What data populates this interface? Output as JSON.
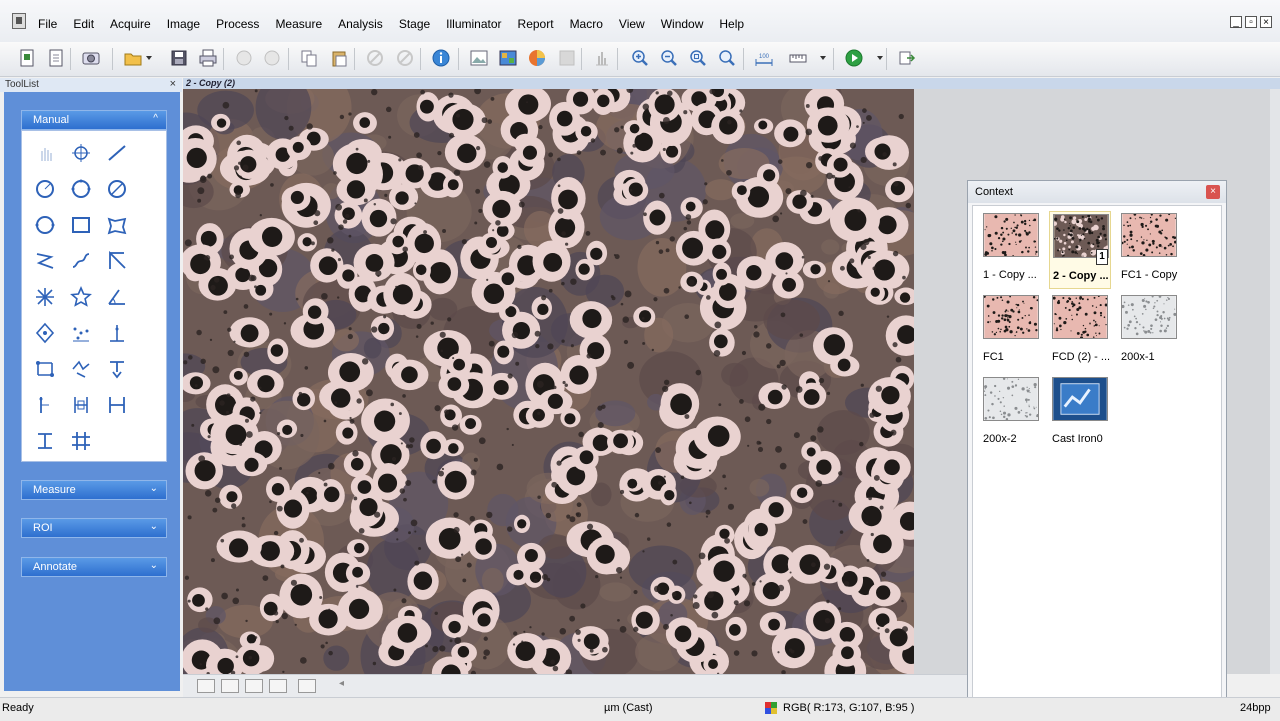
{
  "menu": {
    "items": [
      "File",
      "Edit",
      "Acquire",
      "Image",
      "Process",
      "Measure",
      "Analysis",
      "Stage",
      "Illuminator",
      "Report",
      "Macro",
      "View",
      "Window",
      "Help"
    ]
  },
  "toolbar": {
    "icons": [
      "new-document",
      "save-document",
      "camera",
      "open-folder",
      "save",
      "print",
      "undo",
      "redo",
      "copy",
      "paste",
      "disabled-a",
      "disabled-b",
      "info",
      "image-a",
      "image-b",
      "image-c",
      "disabled-c",
      "histogram",
      "zoom-in",
      "zoom-out",
      "zoom-fit",
      "zoom-actual",
      "scale-100",
      "calibration",
      "play",
      "export"
    ]
  },
  "toollist": {
    "title": "ToolList",
    "close": "×",
    "sections": [
      {
        "label": "Manual",
        "chevron": "^"
      },
      {
        "label": "Measure",
        "chevron": "⌄"
      },
      {
        "label": "ROI",
        "chevron": "⌄"
      },
      {
        "label": "Annotate",
        "chevron": "⌄"
      }
    ],
    "tools": [
      "hand-icon",
      "crosshair-icon",
      "line-icon",
      "circle-icon",
      "circle-points-icon",
      "circle-diameter-icon",
      "polygon-circle-icon",
      "rectangle-icon",
      "freehand-rect-icon",
      "polyline-icon",
      "curve-icon",
      "angle-lines-icon",
      "star-cross-icon",
      "star-icon",
      "angle-icon",
      "polygon-nodes-icon",
      "scatter-points-icon",
      "vertical-measure-icon",
      "transform-icon",
      "path-icon",
      "text-pointer-icon",
      "vertical-dim-icon",
      "dimension-bracket-icon",
      "horizontal-dim-icon",
      "t-cross-icon",
      "grid-icon"
    ]
  },
  "document": {
    "tab_title": "2 - Copy (2)"
  },
  "context": {
    "title": "Context",
    "close": "×",
    "thumbs": [
      {
        "label": "1 - Copy ...",
        "style": "pink",
        "selected": false
      },
      {
        "label": "2 - Copy ...",
        "style": "dark",
        "selected": true,
        "badge": "1"
      },
      {
        "label": "FC1 - Copy",
        "style": "pink",
        "selected": false
      },
      {
        "label": "FC1",
        "style": "pink",
        "selected": false
      },
      {
        "label": "FCD (2) - ...",
        "style": "pink",
        "selected": false
      },
      {
        "label": "200x-1",
        "style": "gray",
        "selected": false
      },
      {
        "label": "200x-2",
        "style": "gray",
        "selected": false
      },
      {
        "label": "Cast Iron0",
        "style": "report",
        "selected": false
      }
    ]
  },
  "status": {
    "left": "Ready",
    "unit": "µm (Cast)",
    "rgb": "RGB( R:173, G:107, B:95 )",
    "bpp": "24bpp"
  },
  "colors": {
    "toollist_bg": "#5f8fd8",
    "section_header": "#2e6fcf",
    "graphite": "#1e1a18",
    "ferrite": "#e8d0cf",
    "pearlite": "#6d5a55"
  }
}
